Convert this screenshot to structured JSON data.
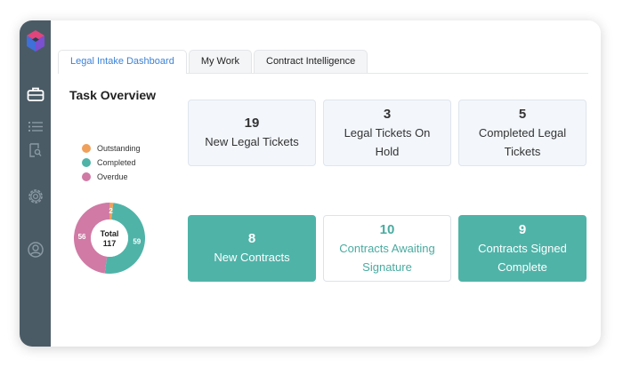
{
  "tabs": [
    {
      "label": "Legal Intake Dashboard",
      "active": true
    },
    {
      "label": "My Work",
      "active": false
    },
    {
      "label": "Contract Intelligence",
      "active": false
    }
  ],
  "task_overview": {
    "title": "Task Overview",
    "legend": [
      {
        "label": "Outstanding",
        "color": "#f0a05a"
      },
      {
        "label": "Completed",
        "color": "#4fb3a8"
      },
      {
        "label": "Overdue",
        "color": "#d07aa5"
      }
    ]
  },
  "chart_data": {
    "type": "pie",
    "categories": [
      "Outstanding",
      "Completed",
      "Overdue"
    ],
    "values": [
      2,
      59,
      56
    ],
    "center_label": "Total",
    "center_value": "117"
  },
  "cards": [
    {
      "number": "19",
      "label": "New Legal Tickets",
      "style": "light"
    },
    {
      "number": "3",
      "label": "Legal Tickets On Hold",
      "style": "light"
    },
    {
      "number": "5",
      "label": "Completed Legal Tickets",
      "style": "light"
    },
    {
      "number": "8",
      "label": "New Contracts",
      "style": "teal"
    },
    {
      "number": "10",
      "label": "Contracts Awaiting Signature",
      "style": "outline"
    },
    {
      "number": "9",
      "label": "Contracts Signed Complete",
      "style": "teal"
    }
  ],
  "colors": {
    "sidebar": "#4a5b66",
    "accent": "#4fb3a8",
    "tab_active": "#3b82d8"
  }
}
